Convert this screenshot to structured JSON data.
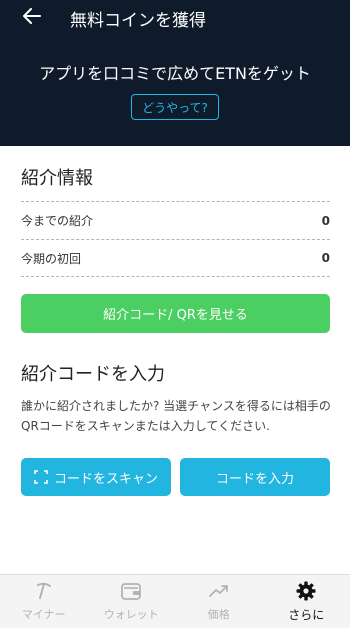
{
  "header": {
    "title": "無料コインを獲得",
    "tagline": "アプリを口コミで広めてETNをゲット",
    "howto_label": "どうやって?"
  },
  "referral_info": {
    "title": "紹介情報",
    "stats": [
      {
        "label": "今までの紹介",
        "value": "0"
      },
      {
        "label": "今期の初回",
        "value": "0"
      }
    ],
    "show_code_label": "紹介コード/ QRを見せる"
  },
  "enter_code": {
    "title": "紹介コードを入力",
    "description": "誰かに紹介されましたか? 当選チャンスを得るには相手のQRコードをスキャンまたは入力してください.",
    "scan_label": "コードをスキャン",
    "input_label": "コードを入力"
  },
  "bottom_nav": {
    "items": [
      {
        "label": "マイナー",
        "icon": "pickaxe-icon"
      },
      {
        "label": "ウォレット",
        "icon": "wallet-icon"
      },
      {
        "label": "価格",
        "icon": "trending-up-icon"
      },
      {
        "label": "さらに",
        "icon": "gear-icon"
      }
    ],
    "active_index": 3
  },
  "colors": {
    "header_bg": "#0f1b2b",
    "accent_blue": "#22b5e0",
    "accent_green": "#4ccf62"
  }
}
